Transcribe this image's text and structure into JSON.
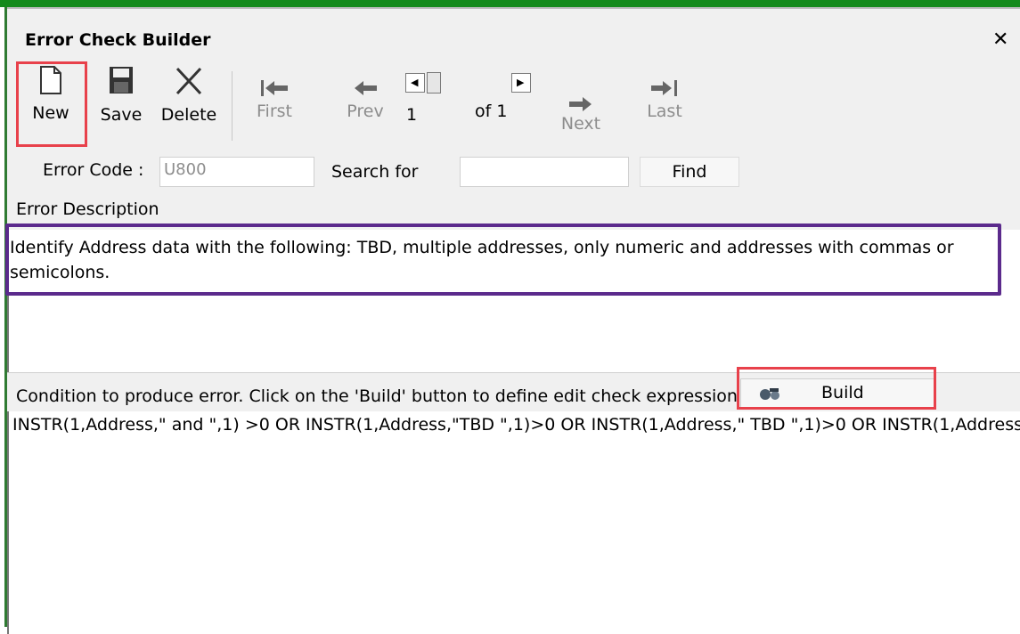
{
  "window": {
    "title": "Error Check Builder",
    "close_glyph": "✕"
  },
  "toolbar": {
    "new_label": "New",
    "save_label": "Save",
    "delete_label": "Delete",
    "first_label": "First",
    "prev_label": "Prev",
    "next_label": "Next",
    "last_label": "Last",
    "record_number": "1",
    "record_of": "of 1"
  },
  "form": {
    "error_code_label": "Error Code :",
    "error_code_value": "U800",
    "search_label": "Search for",
    "search_value": "",
    "find_label": "Find",
    "error_description_label": "Error Description",
    "error_description_text": "Identify Address data with the following:   TBD, multiple addresses, only numeric and addresses with commas or semicolons."
  },
  "condition": {
    "label": "Condition to produce error. Click on the 'Build' button to define edit check expression",
    "build_label": "Build",
    "expression": "INSTR(1,Address,\" and \",1) >0 OR INSTR(1,Address,\"TBD \",1)>0 OR INSTR(1,Address,\" TBD \",1)>0 OR INSTR(1,Address"
  },
  "colors": {
    "title_bar_green": "#148a1c",
    "highlight_red": "#e8414b",
    "highlight_purple": "#5b2a8c"
  },
  "icons": [
    "new-document-icon",
    "save-disk-icon",
    "delete-scissors-icon",
    "first-record-icon",
    "prev-record-icon",
    "next-record-icon",
    "last-record-icon",
    "build-tool-icon"
  ]
}
